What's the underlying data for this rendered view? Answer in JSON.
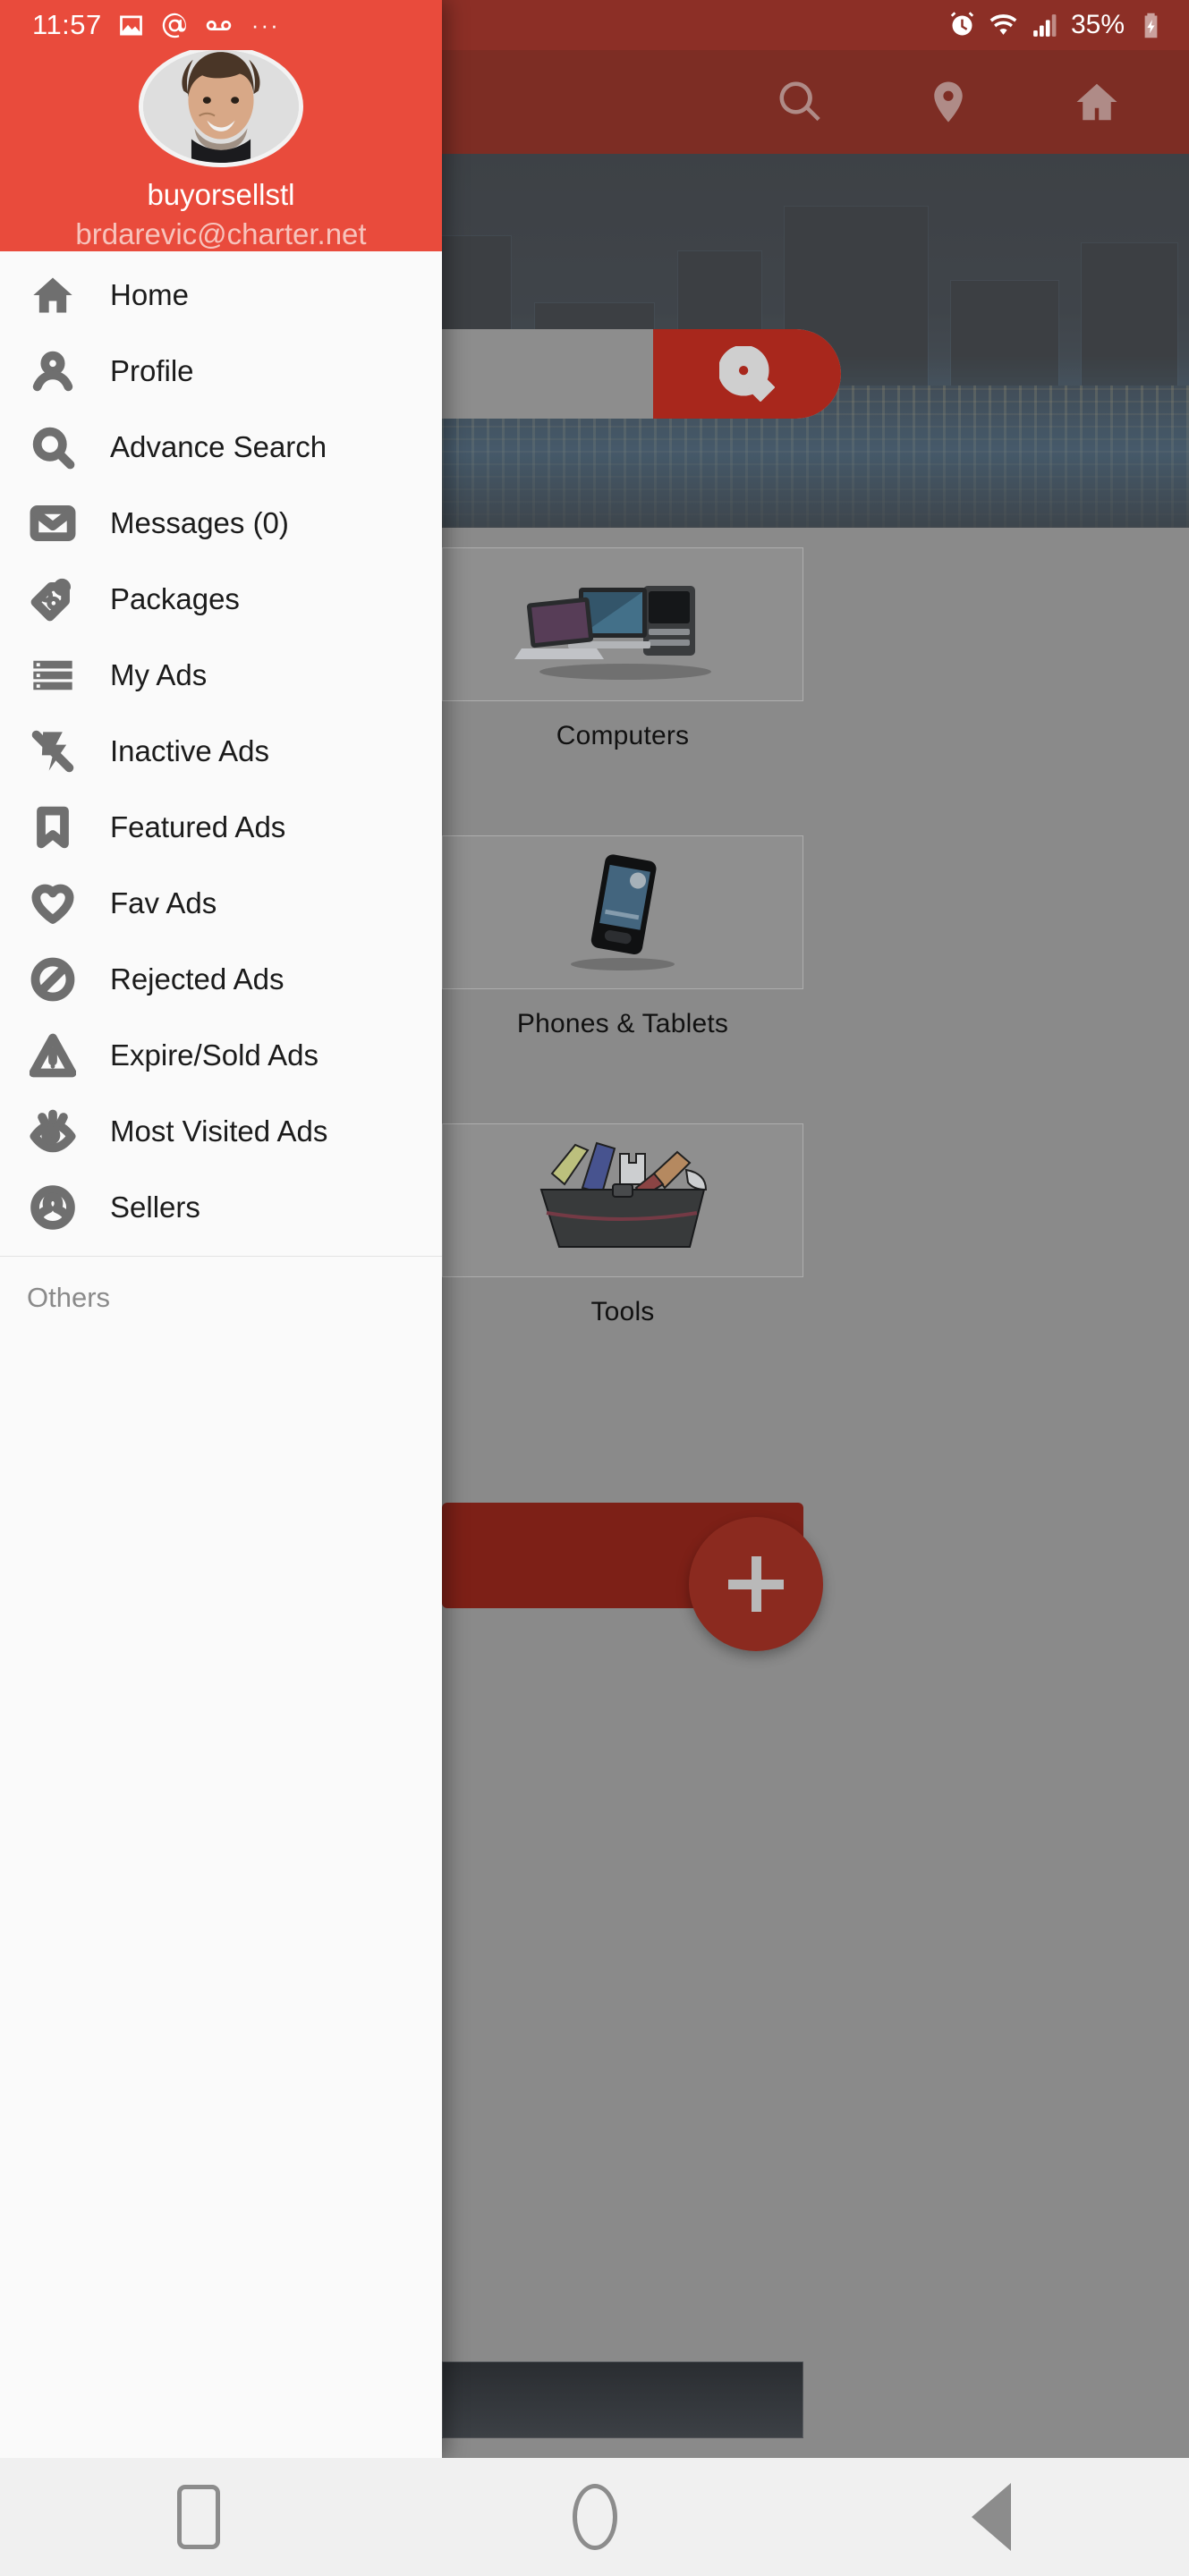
{
  "status_bar": {
    "time": "11:57",
    "left_icons": [
      "image-icon",
      "at-icon",
      "voicemail-icon",
      "more-dots-icon"
    ],
    "right_icons": [
      "alarm-icon",
      "wifi-icon",
      "signal-icon"
    ],
    "battery_percent": "35%",
    "battery_icon": "battery-charging-icon"
  },
  "drawer": {
    "header": {
      "username": "buyorsellstl",
      "email": "brdarevic@charter.net",
      "avatar": "user-photo-avatar"
    },
    "items": [
      {
        "label": "Home",
        "icon": "home-icon"
      },
      {
        "label": "Profile",
        "icon": "person-icon"
      },
      {
        "label": "Advance Search",
        "icon": "search-icon"
      },
      {
        "label": "Messages (0)",
        "icon": "mail-icon"
      },
      {
        "label": "Packages",
        "icon": "price-tag-icon"
      },
      {
        "label": "My Ads",
        "icon": "list-icon"
      },
      {
        "label": "Inactive Ads",
        "icon": "flash-off-icon"
      },
      {
        "label": "Featured Ads",
        "icon": "bookmark-icon"
      },
      {
        "label": "Fav Ads",
        "icon": "heart-icon"
      },
      {
        "label": "Rejected Ads",
        "icon": "block-icon"
      },
      {
        "label": "Expire/Sold Ads",
        "icon": "warning-triangle-icon"
      },
      {
        "label": "Most Visited Ads",
        "icon": "eye-icon"
      },
      {
        "label": "Sellers",
        "icon": "user-circle-icon"
      }
    ],
    "section_label": "Others"
  },
  "app": {
    "toolbar_icons": [
      "search-icon",
      "location-pin-icon",
      "home-icon"
    ],
    "search": {
      "placeholder": "",
      "button_icon": "search-icon"
    },
    "categories": [
      {
        "label": "Computers",
        "image": "computers-thumbnail"
      },
      {
        "label": "Phones & Tablets",
        "image": "phone-thumbnail"
      },
      {
        "label": "Tools",
        "image": "toolbox-thumbnail"
      }
    ],
    "fab": {
      "icon": "plus-icon"
    }
  },
  "navigation_bar": {
    "buttons": [
      {
        "icon": "recents-square-icon"
      },
      {
        "icon": "home-circle-icon"
      },
      {
        "icon": "back-triangle-icon"
      }
    ]
  },
  "colors": {
    "brand_red": "#e94b3c",
    "dim_overlay": "#8a8a8a",
    "drawer_bg": "#fafafa",
    "icon_gray": "#6f6f6f"
  }
}
